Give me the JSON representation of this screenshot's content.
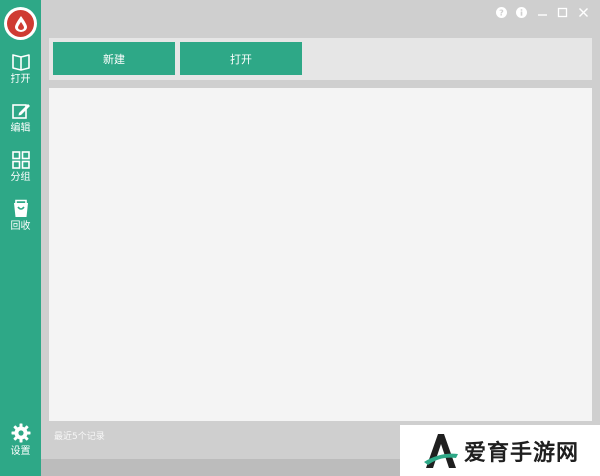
{
  "sidebar": {
    "items": [
      {
        "label": "打开",
        "icon": "book-icon"
      },
      {
        "label": "编辑",
        "icon": "edit-icon"
      },
      {
        "label": "分组",
        "icon": "grid-icon"
      },
      {
        "label": "回收",
        "icon": "trash-bag-icon"
      }
    ],
    "settings_label": "设置"
  },
  "toolbar": {
    "new_label": "新建",
    "open_label": "打开"
  },
  "footer": {
    "recent_label": "最近5个记录"
  },
  "watermark": {
    "text": "爱育手游网"
  },
  "colors": {
    "accent": "#2ea887",
    "logo_red": "#cf3b33",
    "background": "#cfcfcf",
    "content": "#f4f4f4"
  }
}
